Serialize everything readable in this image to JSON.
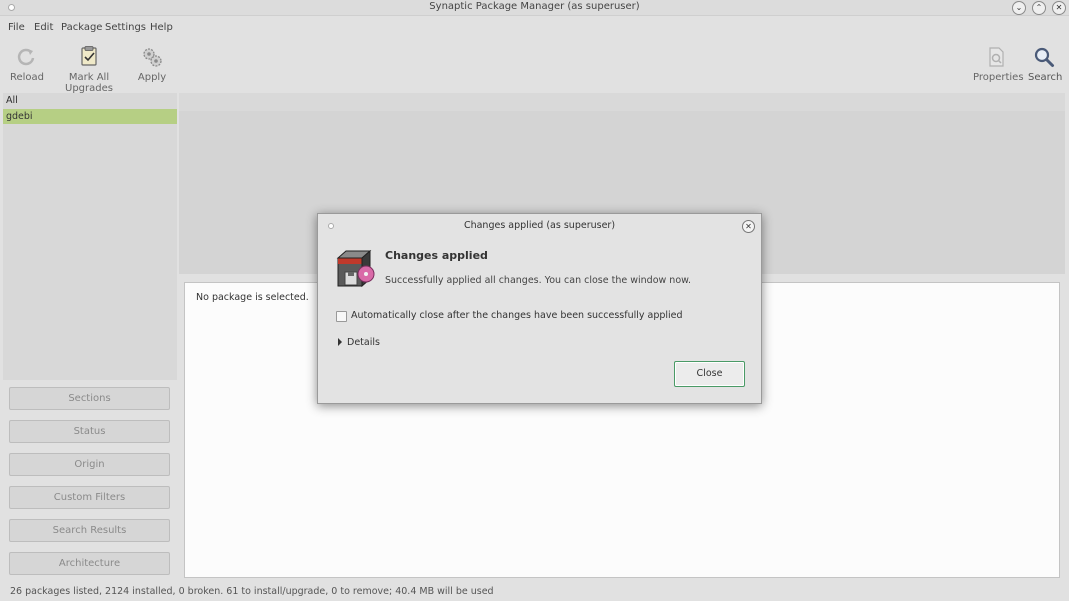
{
  "window": {
    "title": "Synaptic Package Manager (as superuser)",
    "controls": {
      "minimize": "⌄",
      "maximize": "⌃",
      "close": "✕"
    }
  },
  "menu": [
    "File",
    "Edit",
    "Package",
    "Settings",
    "Help"
  ],
  "toolbar": {
    "reload": "Reload",
    "mark_all_upgrades": "Mark All Upgrades",
    "apply": "Apply",
    "properties": "Properties",
    "search": "Search"
  },
  "filters": {
    "items": [
      "All",
      "gdebi"
    ],
    "selected": "gdebi"
  },
  "side_buttons": [
    "Sections",
    "Status",
    "Origin",
    "Custom Filters",
    "Search Results",
    "Architecture"
  ],
  "details": {
    "empty_text": "No package is selected."
  },
  "statusbar": "26 packages listed, 2124 installed, 0 broken. 61 to install/upgrade, 0 to remove; 40.4 MB will be used",
  "dialog": {
    "title": "Changes applied (as superuser)",
    "heading": "Changes applied",
    "message": "Successfully applied all changes. You can close the window now.",
    "auto_close_label": "Automatically close after the changes have been successfully applied",
    "auto_close_checked": false,
    "details_label": "Details",
    "close_button": "Close"
  },
  "colors": {
    "selected_row": "#b6cf84",
    "default_button_border": "#4a9a66"
  }
}
